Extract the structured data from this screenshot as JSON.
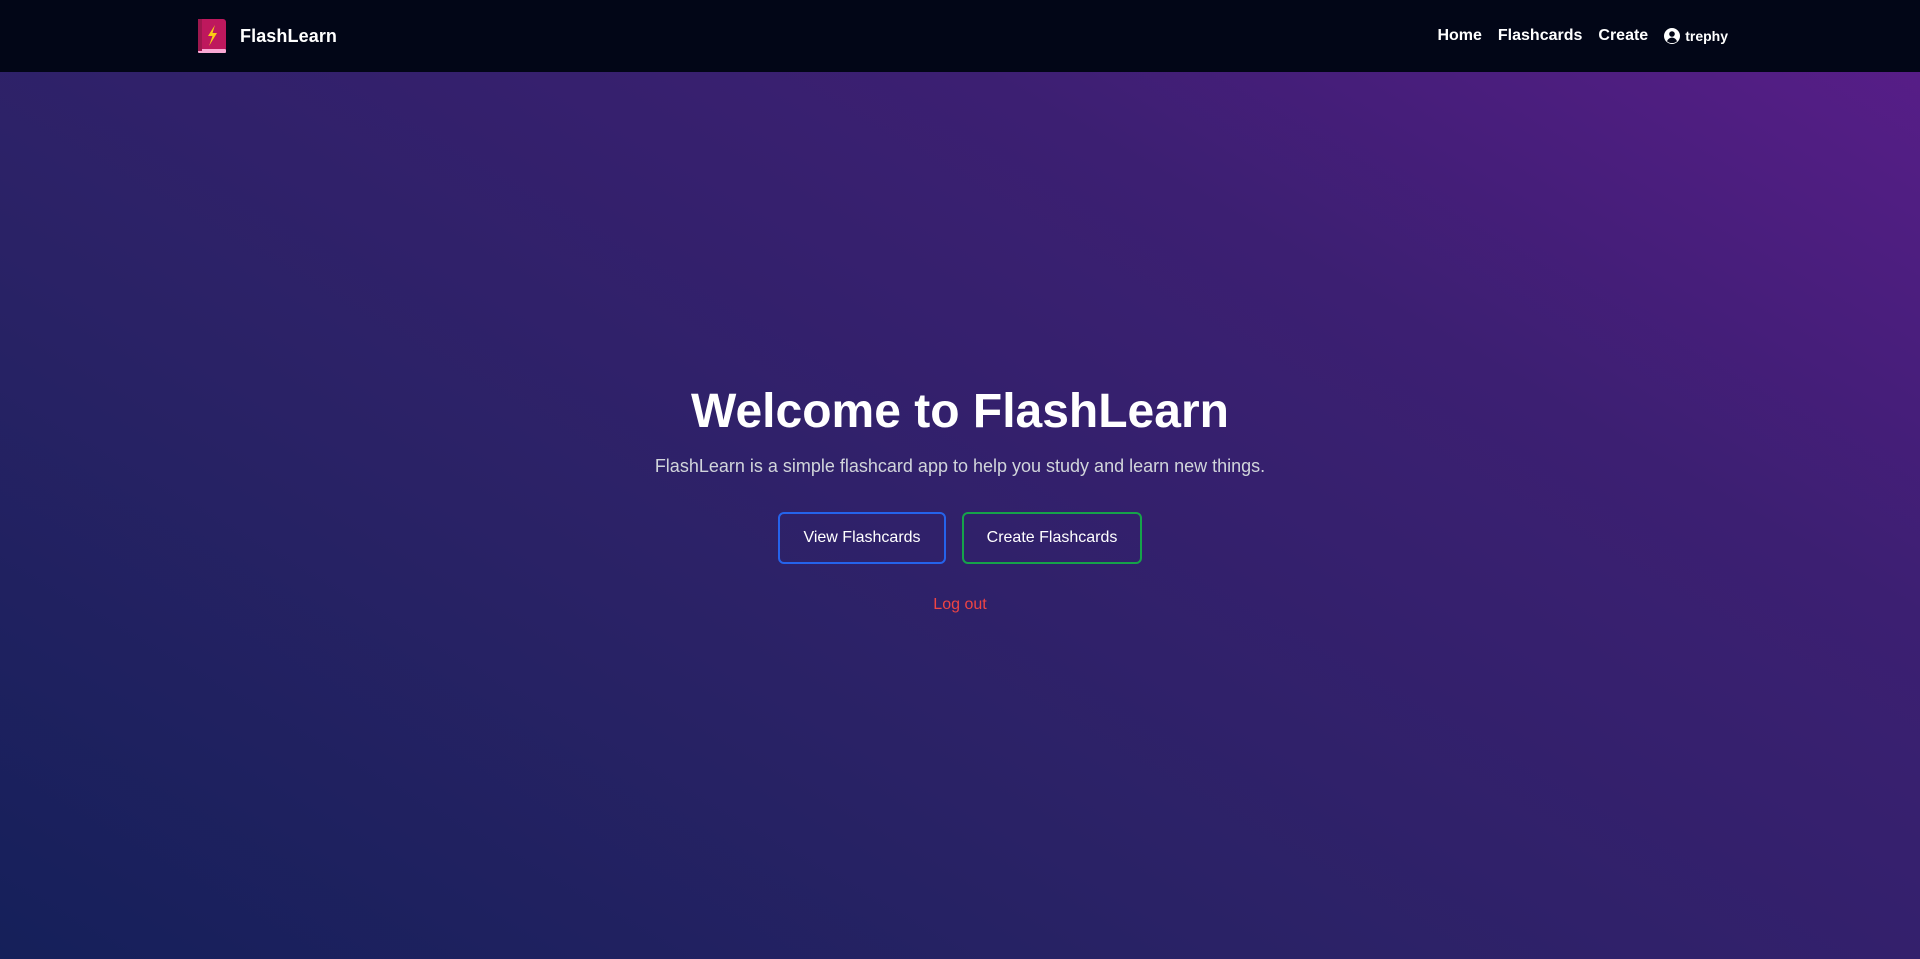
{
  "nav": {
    "brand": "FlashLearn",
    "logo_icon": "lightning-book-icon",
    "links": [
      "Home",
      "Flashcards",
      "Create"
    ],
    "user": {
      "icon": "user-circle-icon",
      "name": "trephy"
    }
  },
  "hero": {
    "title": "Welcome to FlashLearn",
    "subtitle": "FlashLearn is a simple flashcard app to help you study and learn new things.",
    "buttons": {
      "view": "View Flashcards",
      "create": "Create Flashcards"
    },
    "logout": "Log out"
  },
  "colors": {
    "navbar_bg": "#020617",
    "view_border": "#2563eb",
    "create_border": "#16a34a",
    "logout_text": "#ef4444",
    "logo_bg": "#be185d",
    "logo_bolt": "#facc15"
  }
}
